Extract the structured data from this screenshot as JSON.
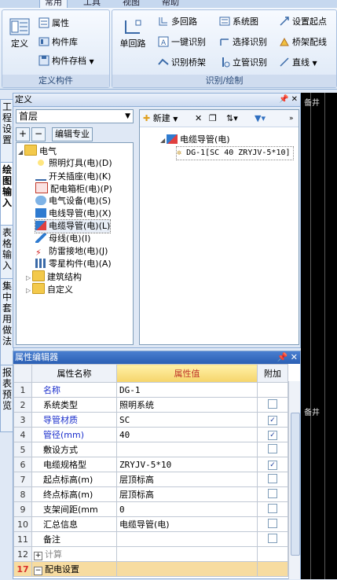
{
  "ribbon": {
    "tabs": [
      "常用",
      "工具",
      "视图",
      "帮助"
    ],
    "group_define": {
      "label": "定义构件",
      "define_btn": "定义",
      "property_btn": "属性",
      "component_lib_btn": "构件库",
      "component_save_btn": "构件存档"
    },
    "group_draw": {
      "label": "识别/绘制",
      "single_loop_btn": "单回路",
      "multi_loop_btn": "多回路",
      "system_diagram_btn": "系统图",
      "set_origin_btn": "设置起点",
      "one_click_btn": "一键识别",
      "select_recognize_btn": "选择识别",
      "bridge_wiring_btn": "桥架配线",
      "recognize_bridge_btn": "识别桥架",
      "riser_recognize_btn": "立管识别",
      "straight_btn": "直线"
    }
  },
  "vtabs": [
    "工程设置",
    "绘图输入",
    "表格输入",
    "集中套用做法",
    "报表预览"
  ],
  "define_panel": {
    "title": "定义",
    "floor": "首层",
    "edit_spec": "编辑专业",
    "tree": {
      "electrical": "电气",
      "items": [
        "照明灯具(电)(D)",
        "开关插座(电)(K)",
        "配电箱柜(电)(P)",
        "电气设备(电)(S)",
        "电线导管(电)(X)",
        "电缆导管(电)(L)",
        "母线(电)(I)",
        "防雷接地(电)(J)",
        "零星构件(电)(A)"
      ],
      "building": "建筑结构",
      "custom": "自定义"
    },
    "toolbar": {
      "new_btn": "新建"
    },
    "component_tree": {
      "root": "电缆导管(电)",
      "child": "DG-1[SC 40 ZRYJV-5*10]"
    }
  },
  "props": {
    "title": "属性编辑器",
    "headers": {
      "name": "属性名称",
      "value": "属性值",
      "attach": "附加"
    },
    "rows": [
      {
        "num": "1",
        "name": "名称",
        "value": "DG-1",
        "attach": ""
      },
      {
        "num": "2",
        "name": "系统类型",
        "value": "照明系统",
        "attach": "unchecked"
      },
      {
        "num": "3",
        "name": "导管材质",
        "value": "SC",
        "attach": "checked"
      },
      {
        "num": "4",
        "name": "管径(mm)",
        "value": "40",
        "attach": "checked"
      },
      {
        "num": "5",
        "name": "敷设方式",
        "value": "",
        "attach": "unchecked"
      },
      {
        "num": "6",
        "name": "电缆规格型",
        "value": "ZRYJV-5*10",
        "attach": "checked"
      },
      {
        "num": "7",
        "name": "起点标高(m)",
        "value": "层顶标高",
        "attach": "unchecked"
      },
      {
        "num": "8",
        "name": "终点标高(m)",
        "value": "层顶标高",
        "attach": "unchecked"
      },
      {
        "num": "9",
        "name": "支架间距(mm",
        "value": "0",
        "attach": "unchecked"
      },
      {
        "num": "10",
        "name": "汇总信息",
        "value": "电缆导管(电)",
        "attach": "unchecked"
      },
      {
        "num": "11",
        "name": "备注",
        "value": "",
        "attach": "unchecked"
      },
      {
        "num": "12",
        "name": "计算",
        "value": "",
        "attach": ""
      },
      {
        "num": "17",
        "name": "配电设置",
        "value": "",
        "attach": ""
      }
    ]
  },
  "drawing": {
    "label1": "备井",
    "label2": "备井"
  }
}
